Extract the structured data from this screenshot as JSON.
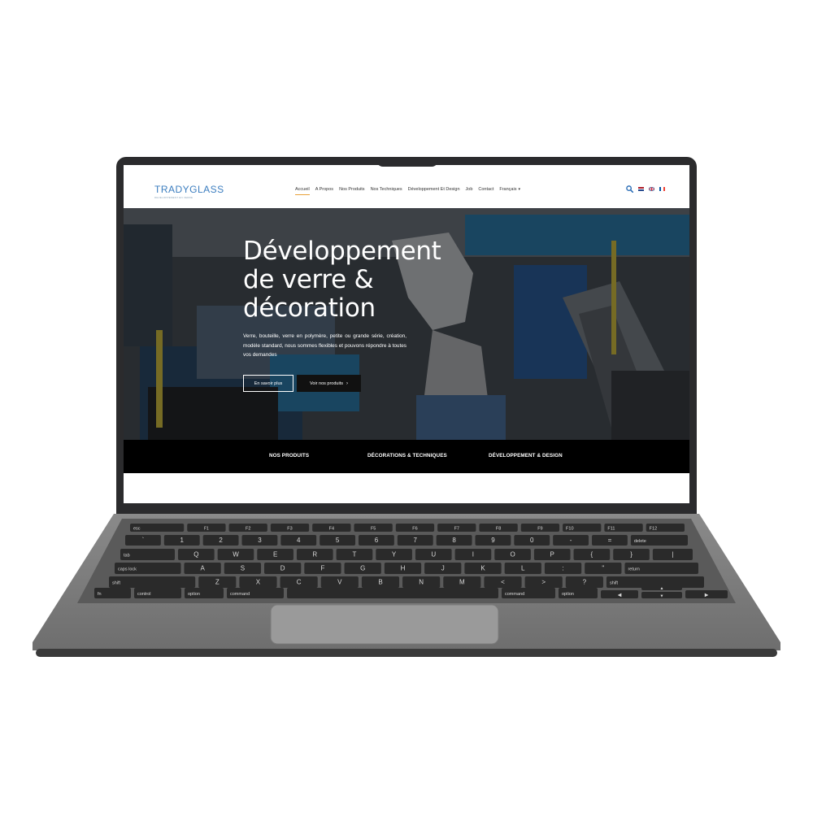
{
  "site": {
    "logo_text": "TRADYGLASS",
    "logo_tagline": "DEVELOPPEMENT EN VERRE"
  },
  "nav": {
    "items": [
      {
        "label": "Accueil",
        "active": true
      },
      {
        "label": "A Propos"
      },
      {
        "label": "Nos Produits"
      },
      {
        "label": "Nos Techniques"
      },
      {
        "label": "Développement Et Design"
      },
      {
        "label": "Job"
      },
      {
        "label": "Contact"
      }
    ],
    "language": "Français"
  },
  "header_icons": [
    "search-icon",
    "flag-nl-icon",
    "flag-en-icon",
    "flag-fr-icon"
  ],
  "hero": {
    "title_lines": [
      "Développement",
      "de verre &",
      "décoration"
    ],
    "description": "Verre, bouteille, verre en polymère, petite ou grande série, création, modèle standard, nous sommes flexibles et pouvons répondre à toutes vos demandes",
    "primary_button": "En savoir plus",
    "secondary_button": "Voir nos produits"
  },
  "categories": [
    "NOS PRODUITS",
    "DÉCORATIONS & TECHNIQUES",
    "DÉVELOPPEMENT & DESIGN"
  ],
  "colors": {
    "accent": "#e8a23a",
    "logo_blue": "#3b7dbf",
    "category_bar": "#000000",
    "laptop_body": "#808080",
    "key": "#2a2a2a"
  },
  "keyboard": {
    "fn_row": [
      "esc",
      "F1",
      "F2",
      "F3",
      "F4",
      "F5",
      "F6",
      "F7",
      "F8",
      "F9",
      "F10",
      "F11",
      "F12"
    ],
    "number_row_top": [
      "~",
      "!",
      "@",
      "#",
      "$",
      "%",
      "^",
      "&",
      "*",
      "(",
      ")",
      "_",
      "+"
    ],
    "number_row": [
      "`",
      "1",
      "2",
      "3",
      "4",
      "5",
      "6",
      "7",
      "8",
      "9",
      "0",
      "-",
      "=",
      "delete"
    ],
    "qwerty_row": [
      "tab",
      "Q",
      "W",
      "E",
      "R",
      "T",
      "Y",
      "U",
      "I",
      "O",
      "P",
      "{",
      "}",
      "|"
    ],
    "home_row": [
      "caps lock",
      "A",
      "S",
      "D",
      "F",
      "G",
      "H",
      "J",
      "K",
      "L",
      ":",
      "\"",
      "return"
    ],
    "shift_row": [
      "shift",
      "Z",
      "X",
      "C",
      "V",
      "B",
      "N",
      "M",
      "<",
      ">",
      "?",
      "shift"
    ],
    "bottom_row": [
      "fn",
      "control",
      "option",
      "command",
      "command",
      "option"
    ],
    "arrow_keys": [
      "◀",
      "▲",
      "▼",
      "▶"
    ]
  }
}
